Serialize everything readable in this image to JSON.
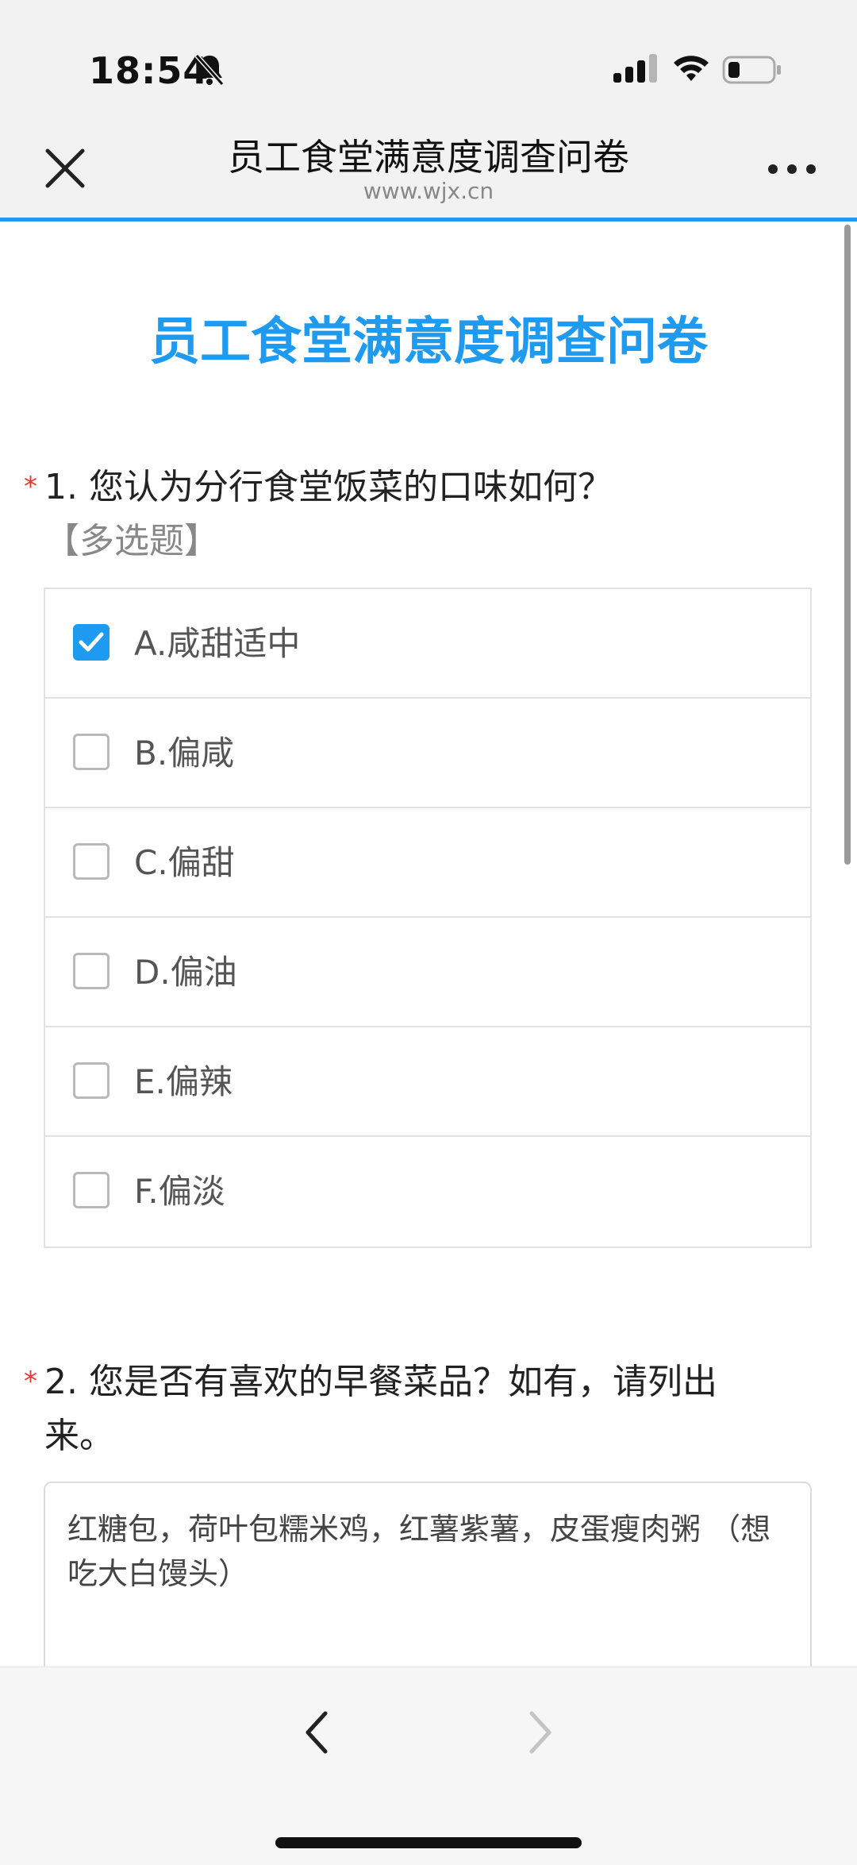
{
  "status_bar": {
    "time": "18:54",
    "icons": [
      "bell-muted-icon",
      "signal-icon",
      "wifi-icon",
      "battery-icon"
    ]
  },
  "nav": {
    "title": "员工食堂满意度调查问卷",
    "url": "www.wjx.cn",
    "icons": [
      "close-icon",
      "more-icon"
    ]
  },
  "survey": {
    "title": "员工食堂满意度调查问卷",
    "questions": [
      {
        "required_mark": "*",
        "text": "1. 您认为分行食堂饭菜的口味如何？",
        "tag": "【多选题】",
        "options": [
          {
            "label": "A.咸甜适中",
            "checked": true
          },
          {
            "label": "B.偏咸",
            "checked": false
          },
          {
            "label": "C.偏甜",
            "checked": false
          },
          {
            "label": "D.偏油",
            "checked": false
          },
          {
            "label": "E.偏辣",
            "checked": false
          },
          {
            "label": "F.偏淡",
            "checked": false
          }
        ]
      },
      {
        "required_mark": "*",
        "text": "2. 您是否有喜欢的早餐菜品？如有，请列出来。",
        "answer": "红糖包，荷叶包糯米鸡，红薯紫薯，皮蛋瘦肉粥 （想吃大白馒头）"
      }
    ]
  },
  "toolbar": {
    "icons": [
      "back-icon",
      "forward-icon"
    ]
  },
  "colors": {
    "accent": "#1e9bf0",
    "required": "#e53935",
    "muted": "#888888"
  }
}
